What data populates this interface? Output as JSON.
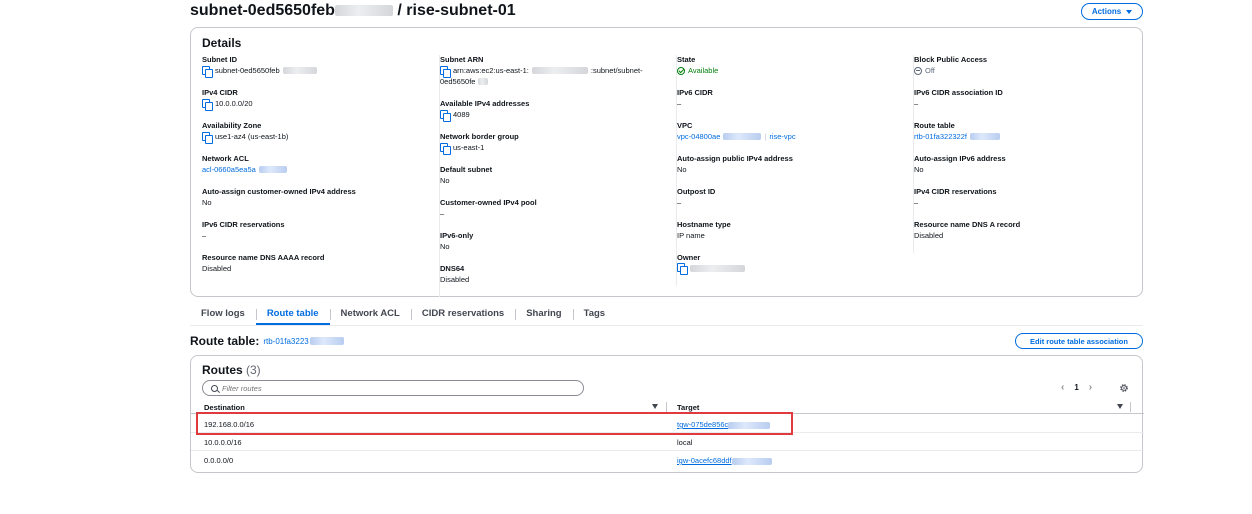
{
  "header": {
    "title_prefix": "subnet-0ed5650feb",
    "title_suffix": " / rise-subnet-01",
    "actions_label": "Actions"
  },
  "details": {
    "title": "Details",
    "columns": [
      [
        {
          "label": "Subnet ID",
          "value": "subnet-0ed5650feb",
          "copy": true,
          "redacted": true
        },
        {
          "label": "IPv4 CIDR",
          "value": "10.0.0.0/20",
          "copy": true
        },
        {
          "label": "Availability Zone",
          "value": "use1-az4 (us-east-1b)",
          "copy": true
        },
        {
          "label": "Network ACL",
          "value": "acl-0660a5ea5a",
          "link": true,
          "redacted": true
        },
        {
          "label": "Auto-assign customer-owned IPv4 address",
          "value": "No"
        },
        {
          "label": "IPv6 CIDR reservations",
          "value": "–"
        },
        {
          "label": "Resource name DNS AAAA record",
          "value": "Disabled"
        }
      ],
      [
        {
          "label": "Subnet ARN",
          "value": "arn:aws:ec2:us-east-1:",
          "value_tail": ":subnet/subnet-",
          "value_line2": "0ed5650fe",
          "copy": true
        },
        {
          "label": "Available IPv4 addresses",
          "value": "4089",
          "copy": true
        },
        {
          "label": "Network border group",
          "value": "us-east-1",
          "copy": true
        },
        {
          "label": "Default subnet",
          "value": "No"
        },
        {
          "label": "Customer-owned IPv4 pool",
          "value": "–"
        },
        {
          "label": "IPv6-only",
          "value": "No"
        },
        {
          "label": "DNS64",
          "value": "Disabled"
        }
      ],
      [
        {
          "label": "State",
          "value": "Available",
          "status": "available"
        },
        {
          "label": "IPv6 CIDR",
          "value": "–"
        },
        {
          "label": "VPC",
          "value": "vpc-04800ae",
          "value_tail": "rise-vpc",
          "link": true
        },
        {
          "label": "Auto-assign public IPv4 address",
          "value": "No"
        },
        {
          "label": "Outpost ID",
          "value": "–"
        },
        {
          "label": "Hostname type",
          "value": "IP name"
        },
        {
          "label": "Owner",
          "value": "",
          "copy": true,
          "redacted": true
        }
      ],
      [
        {
          "label": "Block Public Access",
          "value": "Off",
          "status": "off"
        },
        {
          "label": "IPv6 CIDR association ID",
          "value": "–"
        },
        {
          "label": "Route table",
          "value": "rtb-01fa322322f",
          "link": true,
          "redacted": true
        },
        {
          "label": "Auto-assign IPv6 address",
          "value": "No"
        },
        {
          "label": "IPv4 CIDR reservations",
          "value": "–"
        },
        {
          "label": "Resource name DNS A record",
          "value": "Disabled"
        }
      ]
    ]
  },
  "tabs": [
    {
      "label": "Flow logs",
      "active": false
    },
    {
      "label": "Route table",
      "active": true
    },
    {
      "label": "Network ACL",
      "active": false
    },
    {
      "label": "CIDR reservations",
      "active": false
    },
    {
      "label": "Sharing",
      "active": false
    },
    {
      "label": "Tags",
      "active": false
    }
  ],
  "route_table": {
    "title": "Route table:",
    "id": "rtb-01fa3223",
    "edit_label": "Edit route table association"
  },
  "routes": {
    "title": "Routes",
    "count": "(3)",
    "filter_placeholder": "Filter routes",
    "page": "1",
    "columns": {
      "destination": "Destination",
      "target": "Target"
    },
    "rows": [
      {
        "destination": "192.168.0.0/16",
        "target": "tgw-075de856c",
        "target_link": true,
        "redacted": true
      },
      {
        "destination": "10.0.0.0/16",
        "target": "local",
        "target_link": false
      },
      {
        "destination": "0.0.0.0/0",
        "target": "igw-0acefc68ddf",
        "target_link": true,
        "redacted": true
      }
    ]
  },
  "colors": {
    "accent": "#006ce0",
    "success": "#037f0c",
    "highlight": "#e0393e"
  }
}
